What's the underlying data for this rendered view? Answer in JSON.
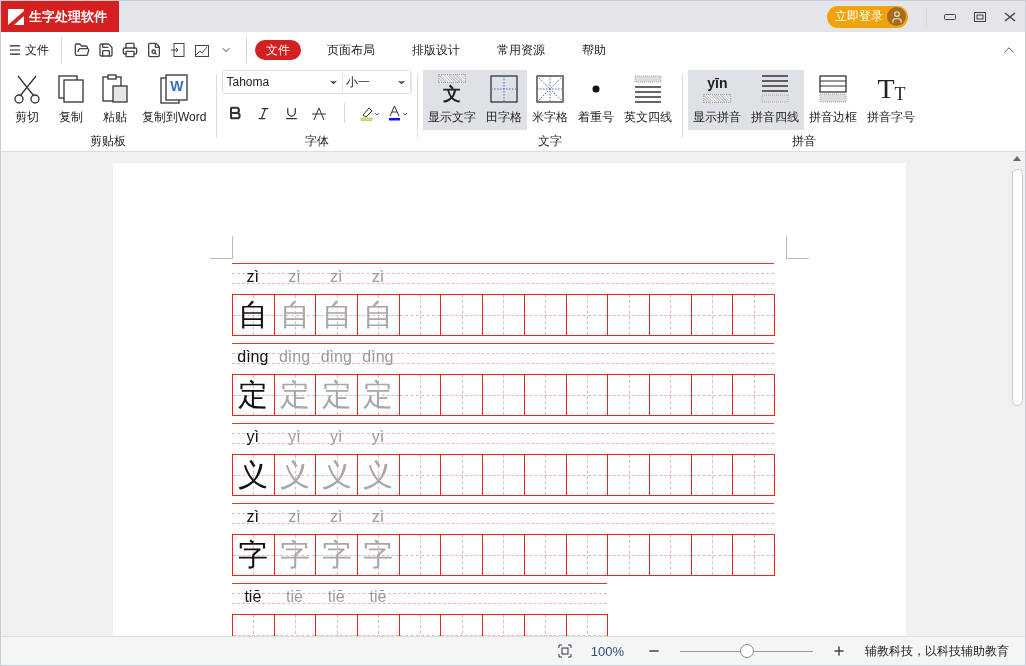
{
  "window": {
    "title": "生字处理软件",
    "login_button": "立即登录"
  },
  "menu": {
    "file_menu": "文件",
    "tabs": [
      {
        "label": "文件",
        "selected": true
      },
      {
        "label": "页面布局",
        "selected": false
      },
      {
        "label": "排版设计",
        "selected": false
      },
      {
        "label": "常用资源",
        "selected": false
      },
      {
        "label": "帮助",
        "selected": false
      }
    ]
  },
  "ribbon": {
    "groups": [
      {
        "label": "剪贴板",
        "kind": "buttons",
        "items": [
          {
            "label": "剪切",
            "kind": "scissors",
            "selected": false
          },
          {
            "label": "复制",
            "kind": "copy",
            "selected": false
          },
          {
            "label": "粘贴",
            "kind": "paste",
            "selected": false
          },
          {
            "label": "复制到Word",
            "kind": "word",
            "glyph": "W",
            "selected": false
          }
        ]
      },
      {
        "label": "字体",
        "kind": "font",
        "font": "Tahoma",
        "size": "小一"
      },
      {
        "label": "文字",
        "kind": "buttons",
        "items": [
          {
            "label": "显示文字",
            "kind": "character",
            "glyph": "文",
            "selected": true
          },
          {
            "label": "田字格",
            "kind": "tian",
            "selected": true
          },
          {
            "label": "米字格",
            "kind": "mi",
            "selected": false
          },
          {
            "label": "着重号",
            "kind": "dot",
            "selected": false
          },
          {
            "label": "英文四线",
            "kind": "fourline",
            "selected": false
          }
        ]
      },
      {
        "label": "拼音",
        "kind": "buttons",
        "items": [
          {
            "label": "显示拼音",
            "kind": "pinyin",
            "glyph": "yīn",
            "selected": true
          },
          {
            "label": "拼音四线",
            "kind": "pinyinline",
            "selected": true
          },
          {
            "label": "拼音边框",
            "kind": "frame",
            "selected": false
          },
          {
            "label": "拼音字号",
            "kind": "tt",
            "glyphs": [
              "T",
              "T"
            ],
            "selected": false
          }
        ]
      }
    ]
  },
  "practice": {
    "rows": [
      {
        "cells": [
          {
            "kind": "model",
            "pinyin": "zì",
            "char": "自"
          },
          {
            "kind": "trace",
            "pinyin": "zì",
            "char": "自"
          },
          {
            "kind": "trace",
            "pinyin": "zì",
            "char": "自"
          },
          {
            "kind": "trace",
            "pinyin": "zì",
            "char": "自"
          },
          {
            "kind": "empty"
          },
          {
            "kind": "empty"
          },
          {
            "kind": "empty"
          },
          {
            "kind": "empty"
          },
          {
            "kind": "empty"
          },
          {
            "kind": "empty"
          },
          {
            "kind": "empty"
          },
          {
            "kind": "empty"
          },
          {
            "kind": "empty"
          }
        ]
      },
      {
        "cells": [
          {
            "kind": "model",
            "pinyin": "dìng",
            "char": "定"
          },
          {
            "kind": "trace",
            "pinyin": "dìng",
            "char": "定"
          },
          {
            "kind": "trace",
            "pinyin": "dìng",
            "char": "定"
          },
          {
            "kind": "trace",
            "pinyin": "dìng",
            "char": "定"
          },
          {
            "kind": "empty"
          },
          {
            "kind": "empty"
          },
          {
            "kind": "empty"
          },
          {
            "kind": "empty"
          },
          {
            "kind": "empty"
          },
          {
            "kind": "empty"
          },
          {
            "kind": "empty"
          },
          {
            "kind": "empty"
          },
          {
            "kind": "empty"
          }
        ]
      },
      {
        "cells": [
          {
            "kind": "model",
            "pinyin": "yì",
            "char": "义"
          },
          {
            "kind": "trace",
            "pinyin": "yì",
            "char": "义"
          },
          {
            "kind": "trace",
            "pinyin": "yì",
            "char": "义"
          },
          {
            "kind": "trace",
            "pinyin": "yì",
            "char": "义"
          },
          {
            "kind": "empty"
          },
          {
            "kind": "empty"
          },
          {
            "kind": "empty"
          },
          {
            "kind": "empty"
          },
          {
            "kind": "empty"
          },
          {
            "kind": "empty"
          },
          {
            "kind": "empty"
          },
          {
            "kind": "empty"
          },
          {
            "kind": "empty"
          }
        ]
      },
      {
        "cells": [
          {
            "kind": "model",
            "pinyin": "zì",
            "char": "字"
          },
          {
            "kind": "trace",
            "pinyin": "zì",
            "char": "字"
          },
          {
            "kind": "trace",
            "pinyin": "zì",
            "char": "字"
          },
          {
            "kind": "trace",
            "pinyin": "zì",
            "char": "字"
          },
          {
            "kind": "empty"
          },
          {
            "kind": "empty"
          },
          {
            "kind": "empty"
          },
          {
            "kind": "empty"
          },
          {
            "kind": "empty"
          },
          {
            "kind": "empty"
          },
          {
            "kind": "empty"
          },
          {
            "kind": "empty"
          },
          {
            "kind": "empty"
          }
        ]
      },
      {
        "cells": [
          {
            "kind": "model",
            "pinyin": "tiē"
          },
          {
            "kind": "trace",
            "pinyin": "tiē"
          },
          {
            "kind": "trace",
            "pinyin": "tiē"
          },
          {
            "kind": "trace",
            "pinyin": "tiē"
          },
          {
            "kind": "empty"
          },
          {
            "kind": "empty"
          },
          {
            "kind": "empty"
          },
          {
            "kind": "empty"
          },
          {
            "kind": "empty"
          }
        ]
      }
    ]
  },
  "status_bar": {
    "zoom": "100%",
    "zoom_slider": {
      "level": 0.5
    },
    "slogan": "辅教科技，以科技辅助教育"
  }
}
